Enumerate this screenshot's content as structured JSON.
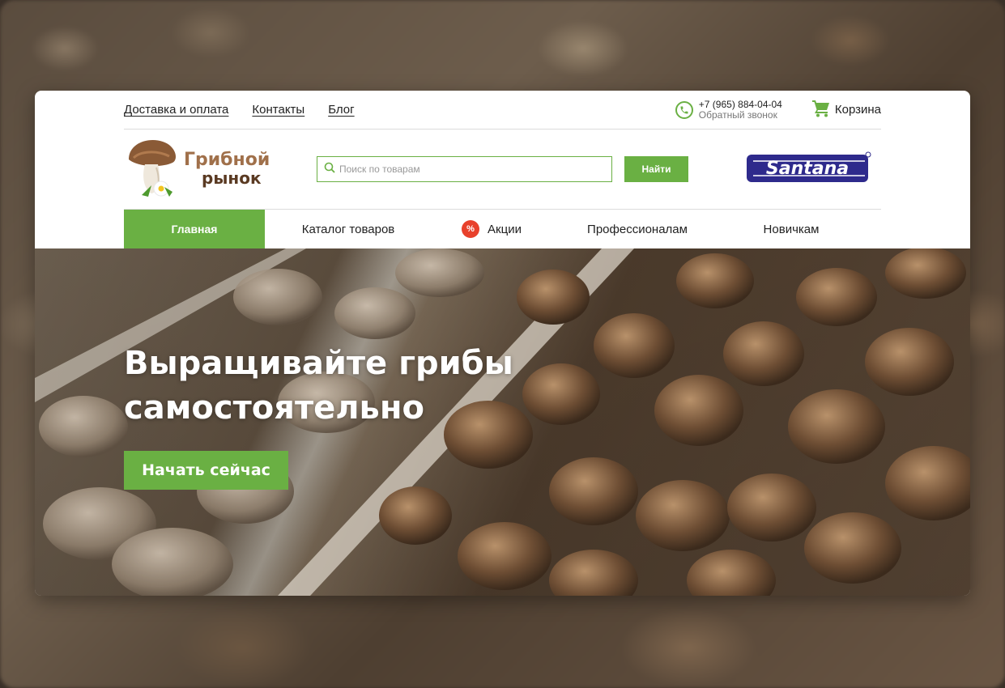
{
  "topbar": {
    "links": [
      "Доставка и оплата",
      "Контакты",
      "Блог"
    ],
    "phone": "+7 (965) 884-04-04",
    "callback": "Обратный звонок",
    "cart_label": "Корзина"
  },
  "header": {
    "logo_line1": "Грибной",
    "logo_line2": "рынок",
    "search_placeholder": "Поиск по товарам",
    "search_button": "Найти",
    "brand_logo_text": "Santana"
  },
  "nav": {
    "items": [
      "Главная",
      "Каталог товаров",
      "Акции",
      "Профессионалам",
      "Новичкам"
    ],
    "active_index": 0,
    "promo_badge": "%"
  },
  "hero": {
    "title_line1": "Выращивайте грибы",
    "title_line2": "самостоятельно",
    "cta_label": "Начать сейчас"
  },
  "colors": {
    "accent": "#6ab043",
    "promo": "#e8412c",
    "brand": "#2e2a8c"
  },
  "icons": [
    "phone-icon",
    "cart-icon",
    "search-icon",
    "mushroom-logo-icon",
    "promo-percent-icon"
  ]
}
